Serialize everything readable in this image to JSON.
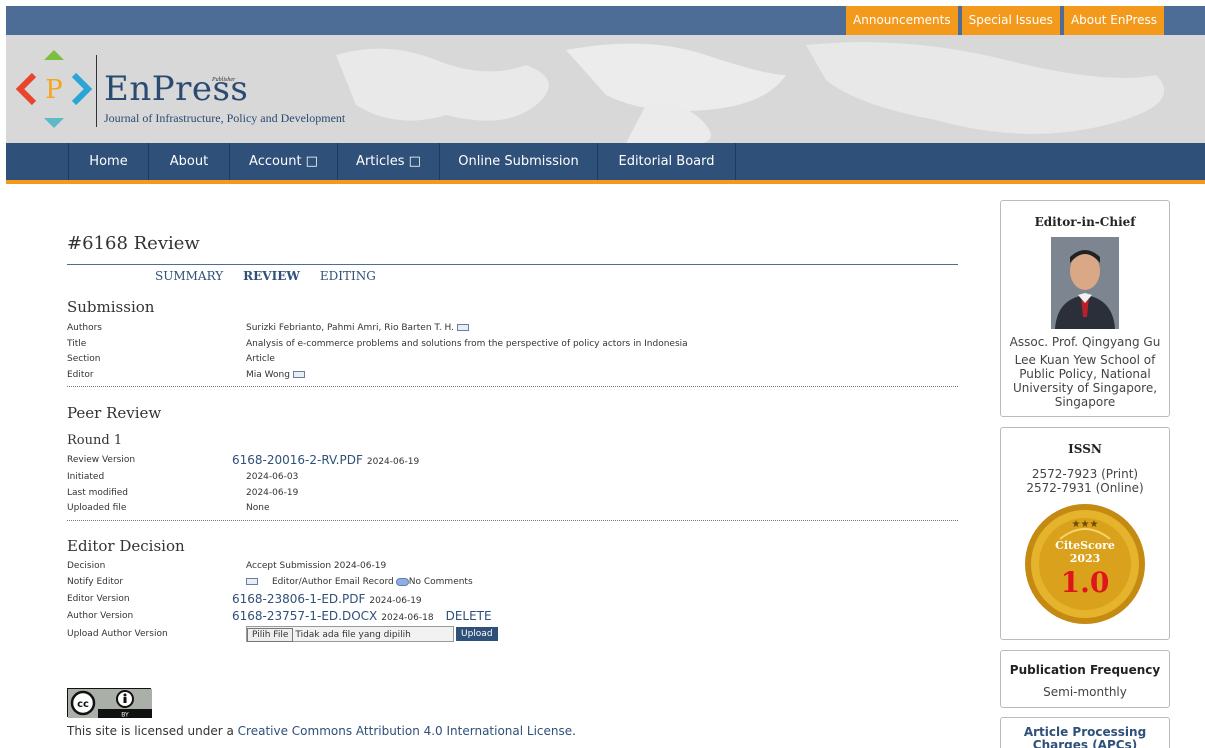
{
  "top_links": [
    "Announcements",
    "Special Issues",
    "About EnPress"
  ],
  "logo": {
    "name": "EnPress",
    "publisher": "Publisher",
    "journal": "Journal of Infrastructure, Policy and Development"
  },
  "nav": [
    "Home",
    "About",
    "Account □",
    "Articles □",
    "Online Submission",
    "Editorial Board"
  ],
  "page": {
    "heading": "#6168 Review",
    "tabs": [
      "SUMMARY",
      "REVIEW",
      "EDITING"
    ],
    "active_tab": "REVIEW"
  },
  "submission": {
    "title": "Submission",
    "rows": [
      {
        "label": "Authors",
        "value": "Surizki Febrianto, Pahmi Amri, Rio Barten T. H."
      },
      {
        "label": "Title",
        "value": "Analysis of e-commerce problems and solutions from the perspective of policy actors in Indonesia"
      },
      {
        "label": "Section",
        "value": "Article"
      },
      {
        "label": "Editor",
        "value": "Mia Wong"
      }
    ]
  },
  "peer_review": {
    "title": "Peer Review",
    "round": "Round 1",
    "rows": [
      {
        "label": "Review Version",
        "file": "6168-20016-2-RV.PDF",
        "date": "2024-06-19"
      },
      {
        "label": "Initiated",
        "value": "2024-06-03"
      },
      {
        "label": "Last modified",
        "value": "2024-06-19"
      },
      {
        "label": "Uploaded file",
        "value": "None"
      }
    ]
  },
  "editor_decision": {
    "title": "Editor Decision",
    "decision_label": "Decision",
    "decision_value": "Accept Submission 2024-06-19",
    "notify_label": "Notify Editor",
    "notify_value": "Editor/Author Email Record",
    "no_comments": "No Comments",
    "editor_version_label": "Editor Version",
    "editor_version_file": "6168-23806-1-ED.PDF",
    "editor_version_date": "2024-06-19",
    "author_version_label": "Author Version",
    "author_version_file": "6168-23757-1-ED.DOCX",
    "author_version_date": "2024-06-18",
    "delete_label": "DELETE",
    "upload_label": "Upload Author Version",
    "choose_file": "Pilih File",
    "no_file": "Tidak ada file yang dipilih",
    "upload_button": "Upload"
  },
  "license": {
    "prefix": "This site is licensed under a ",
    "link": "Creative Commons Attribution 4.0 International License",
    "suffix": ".",
    "badge_text": "BY"
  },
  "sidebar": {
    "editor_in_chief": {
      "title": "Editor-in-Chief",
      "name": "Assoc. Prof. Qingyang Gu",
      "affiliation": "Lee Kuan Yew School of Public Policy, National University of Singapore, Singapore"
    },
    "issn": {
      "title": "ISSN",
      "print": "2572-7923 (Print)",
      "online": "2572-7931 (Online)",
      "citescore_label": "CiteScore",
      "citescore_year": "2023",
      "citescore_value": "1.0"
    },
    "frequency": {
      "title": "Publication Frequency",
      "value": "Semi-monthly"
    },
    "apc": {
      "title": "Article Processing Charges (APCs)"
    }
  },
  "colors": {
    "header_blue": "#4d6d97",
    "nav_blue": "#2e5079",
    "accent_orange": "#f39a1c",
    "link_blue": "#2e5079"
  }
}
